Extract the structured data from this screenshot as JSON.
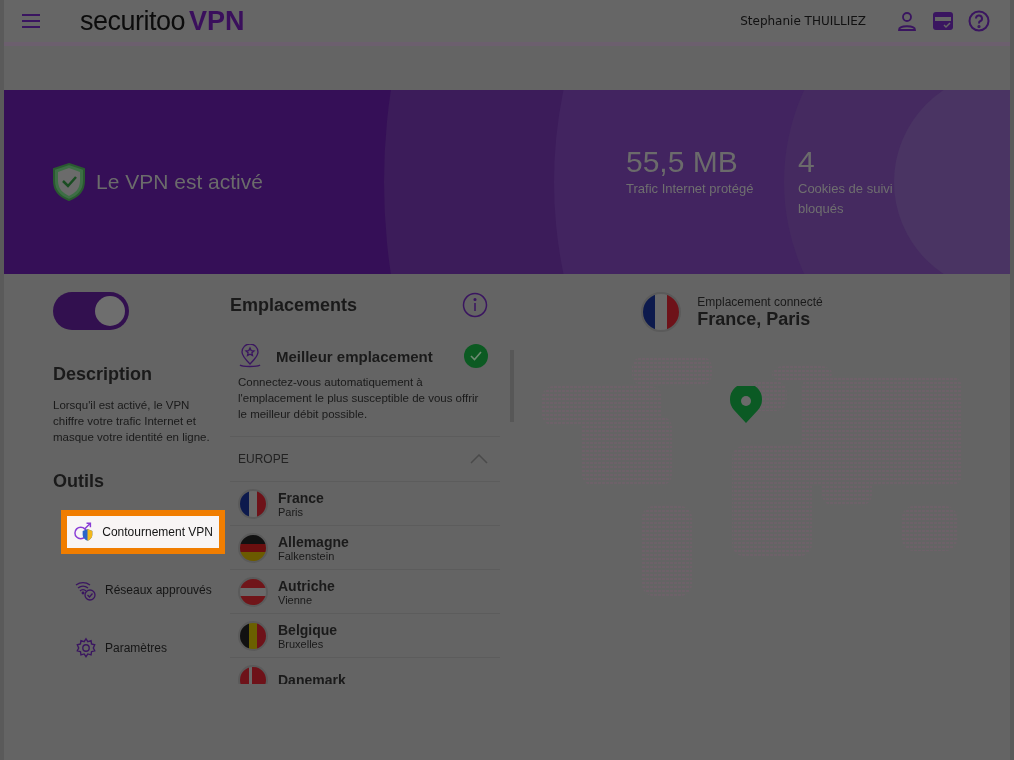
{
  "header": {
    "logo_main": "securitoo",
    "logo_suffix": "VPN",
    "user_name": "Stephanie THUILLIEZ"
  },
  "banner": {
    "status": "Le VPN est activé",
    "stats": [
      {
        "value": "55,5 MB",
        "label": "Trafic Internet protégé"
      },
      {
        "value": "4",
        "label": "Cookies de suivi bloqués"
      }
    ]
  },
  "vpn_toggle": {
    "on": true
  },
  "description": {
    "title": "Description",
    "text": "Lorsqu'il est activé, le VPN chiffre votre trafic Internet et masque votre identité en ligne."
  },
  "tools": {
    "title": "Outils",
    "items": [
      {
        "kind": "bypass",
        "label": "Contournement VPN",
        "highlighted": true
      },
      {
        "kind": "wifi",
        "label": "Réseaux approuvés",
        "highlighted": false
      },
      {
        "kind": "settings",
        "label": "Paramètres",
        "highlighted": false
      }
    ]
  },
  "locations": {
    "title": "Emplacements",
    "best": {
      "title": "Meilleur emplacement",
      "text": "Connectez-vous automatiquement à l'emplacement le plus susceptible de vous offrir le meilleur débit possible.",
      "selected": true
    },
    "region": {
      "name": "EUROPE",
      "expanded": true
    },
    "countries": [
      {
        "name": "France",
        "city": "Paris",
        "kind": "fr"
      },
      {
        "name": "Allemagne",
        "city": "Falkenstein",
        "kind": "de"
      },
      {
        "name": "Autriche",
        "city": "Vienne",
        "kind": "at"
      },
      {
        "name": "Belgique",
        "city": "Bruxelles",
        "kind": "be"
      },
      {
        "name": "Danemark",
        "kind": "dk"
      }
    ]
  },
  "connected": {
    "label": "Emplacement connecté",
    "location": "France, Paris",
    "kind": "fr"
  }
}
